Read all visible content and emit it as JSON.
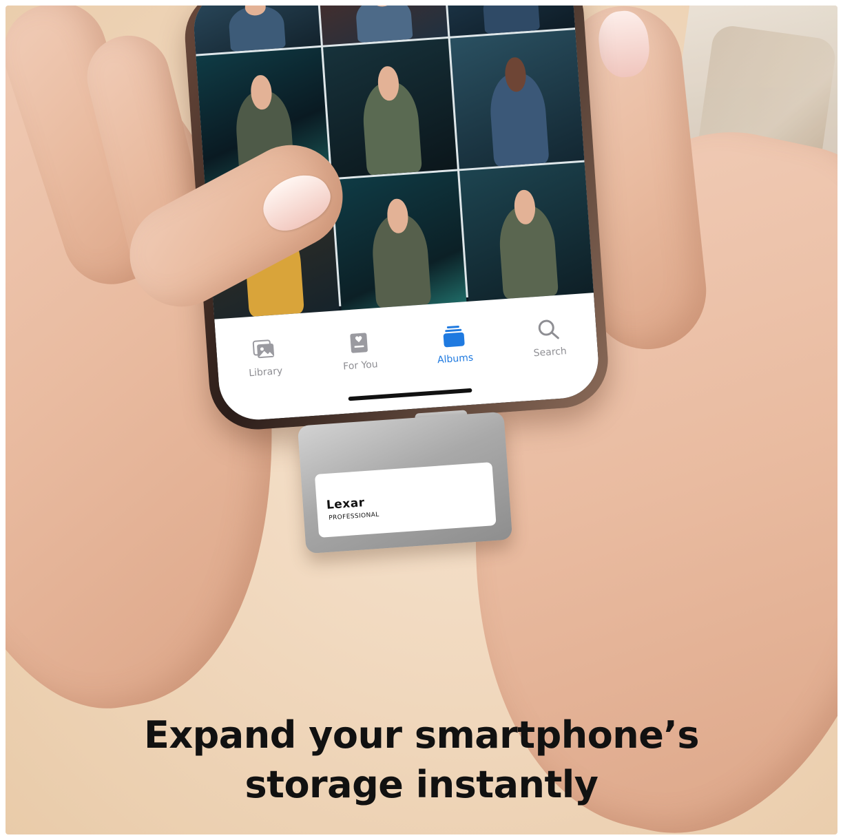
{
  "tabs": [
    {
      "label": "Library",
      "icon": "photo-stack-icon",
      "active": false
    },
    {
      "label": "For You",
      "icon": "for-you-icon",
      "active": false
    },
    {
      "label": "Albums",
      "icon": "albums-icon",
      "active": true
    },
    {
      "label": "Search",
      "icon": "search-icon",
      "active": false
    }
  ],
  "device": {
    "brand": "Lexar",
    "line": "PROFESSIONAL"
  },
  "headline": {
    "line1": "Expand your smartphone’s",
    "line2": "storage instantly"
  },
  "colors": {
    "accent": "#1f7ae0",
    "background": "#f1d9bf",
    "text": "#111111"
  }
}
